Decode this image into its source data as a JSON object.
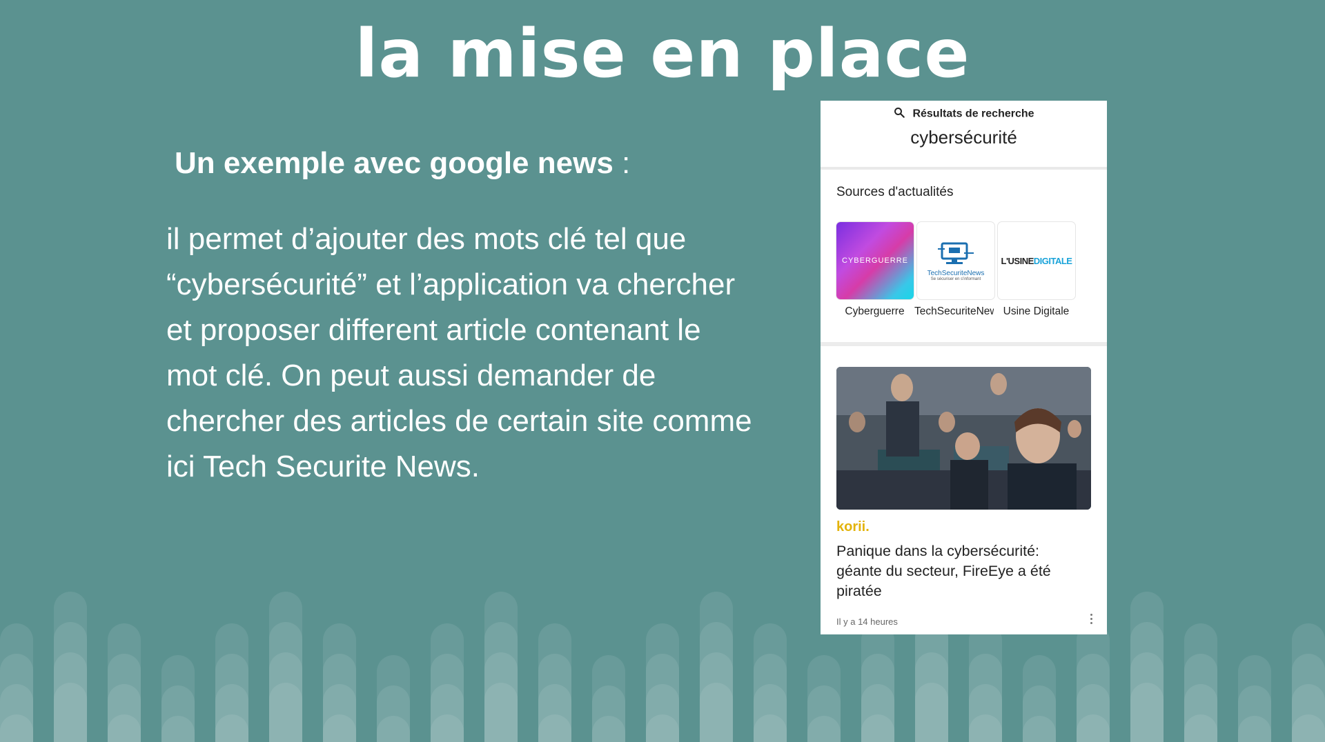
{
  "slide": {
    "title": "la mise en place",
    "subtitle_bold": "Un exemple avec google news",
    "subtitle_colon": " :",
    "body": "il permet d’ajouter des mots clé tel que “cybersécurité” et l’application va chercher et proposer different article contenant le mot clé. On peut aussi demander de chercher des articles de certain site comme ici Tech Securite News."
  },
  "phone": {
    "header_label": "Résultats de recherche",
    "query": "cybersécurité",
    "sources_title": "Sources d'actualités",
    "sources": [
      {
        "label": "Cyberguerre",
        "logo_text": "CYBERGUERRE"
      },
      {
        "label": "TechSecuriteNews",
        "logo_text": "TechSecuriteNews",
        "logo_tagline": "Se sécuriser en s'informant"
      },
      {
        "label": "Usine Digitale",
        "logo_text_a": "L'USINE",
        "logo_text_b": "DIGITALE"
      }
    ],
    "article": {
      "source": "korii.",
      "title": "Panique dans la cybersécurité: géante du secteur, FireEye a été piratée",
      "time": "Il y a 14 heures"
    }
  },
  "colors": {
    "background": "#5b9290",
    "stripe": "#ffffff",
    "korii": "#e3b30a"
  },
  "icons": [
    "search-icon",
    "more-vert-icon"
  ]
}
